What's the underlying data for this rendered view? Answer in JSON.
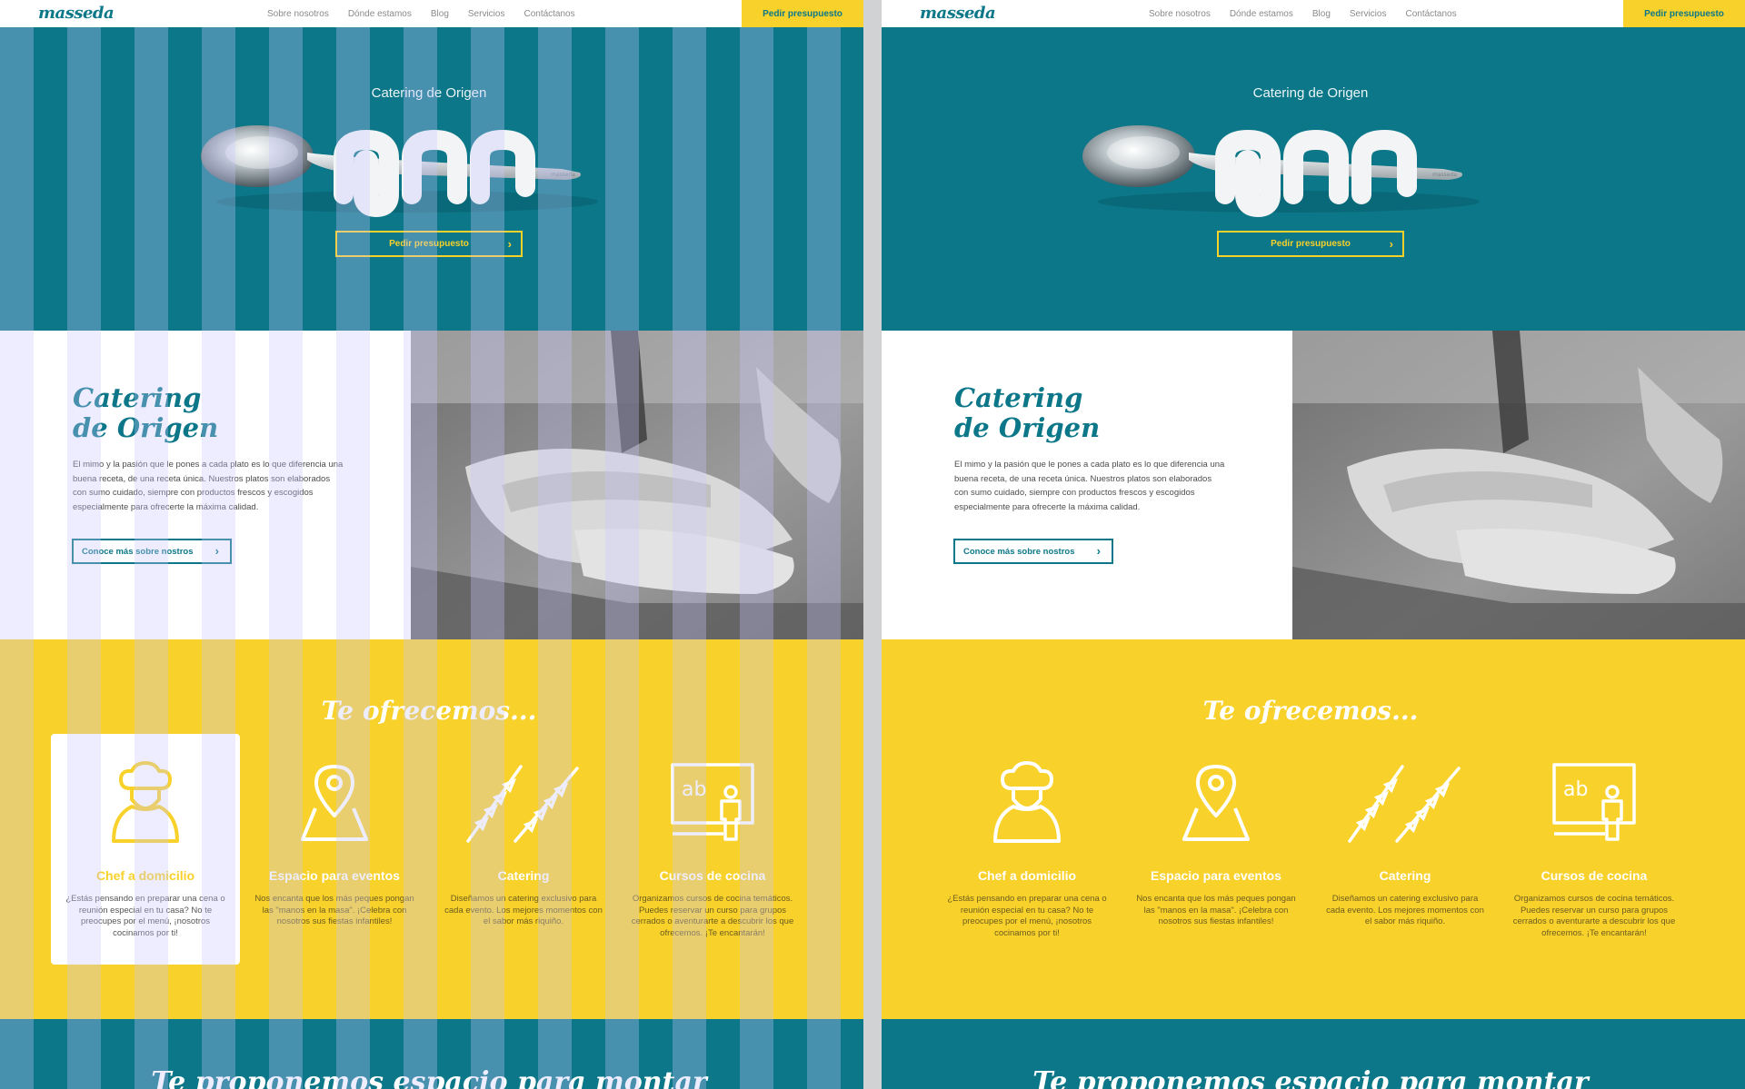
{
  "brand": {
    "logo": "masseda",
    "teal": "#0b7788",
    "yellow": "#f8d12a"
  },
  "nav": {
    "links": [
      "Sobre nosotros",
      "Dónde estamos",
      "Blog",
      "Servicios",
      "Contáctanos"
    ],
    "cta": "Pedir presupuesto"
  },
  "hero": {
    "title": "Catering de Origen",
    "button": "Pedir presupuesto",
    "spoon_engraving": "masseda"
  },
  "about": {
    "heading_line1": "Catering",
    "heading_line2": "de Origen",
    "text": "El mimo y la pasión que le pones a cada plato es lo que diferencia una buena receta, de una receta única. Nuestros platos son elaborados con sumo cuidado, siempre con productos frescos y escogidos especialmente para ofrecerte la máxima calidad.",
    "button": "Conoce más sobre nostros"
  },
  "services": {
    "title": "Te ofrecemos...",
    "items": [
      {
        "icon": "chef-icon",
        "name": "Chef a domicilio",
        "desc": "¿Estás pensando en preparar una cena o reunión especial en tu casa? No te preocupes por el menú, ¡nosotros cocinamos por ti!"
      },
      {
        "icon": "map-pin-icon",
        "name": "Espacio para eventos",
        "desc": "Nos encanta que los más peques pongan las \"manos en la masa\". ¡Celebra con nosotros sus fiestas infantiles!"
      },
      {
        "icon": "skewers-icon",
        "name": "Catering",
        "desc": "Diseñamos un catering exclusivo para cada evento. Los mejores momentos con el sabor más riquiño."
      },
      {
        "icon": "blackboard-icon",
        "name": "Cursos de cocina",
        "desc": "Organizamos cursos de cocina temáticos. Puedes reservar un curso para grupos cerrados o aventurarte a descubrir los que ofrecemos. ¡Te encantarán!"
      }
    ]
  },
  "bottom": {
    "title": "Te proponemos espacio para montar"
  }
}
